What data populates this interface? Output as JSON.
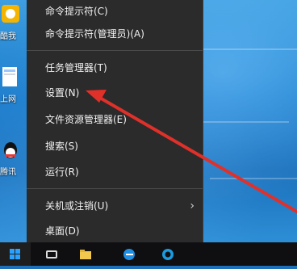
{
  "desktop": {
    "icons": [
      {
        "label": "酷我",
        "name": "kuwo-icon"
      },
      {
        "label": "上网",
        "name": "browser-icon"
      },
      {
        "label": "腾讯",
        "name": "qq-icon"
      }
    ]
  },
  "context_menu": {
    "items": [
      {
        "label": "命令提示符(C)"
      },
      {
        "label": "命令提示符(管理员)(A)"
      },
      {
        "label": "任务管理器(T)"
      },
      {
        "label": "设置(N)"
      },
      {
        "label": "文件资源管理器(E)"
      },
      {
        "label": "搜索(S)"
      },
      {
        "label": "运行(R)"
      },
      {
        "label": "关机或注销(U)",
        "submenu_icon": "chevron-right-icon"
      },
      {
        "label": "桌面(D)"
      }
    ]
  },
  "colors": {
    "menu_bg": "#2b2b2b",
    "menu_text": "#f2f2f2",
    "separator": "#4a4a4a",
    "annotation_arrow": "#e0302a",
    "taskbar_bg": "#0f0f12",
    "accent_blue": "#1d6fb8"
  },
  "taskbar": {
    "icons": [
      "windows-start-icon",
      "task-view-icon",
      "file-explorer-icon",
      "edge-icon",
      "store-icon"
    ]
  }
}
